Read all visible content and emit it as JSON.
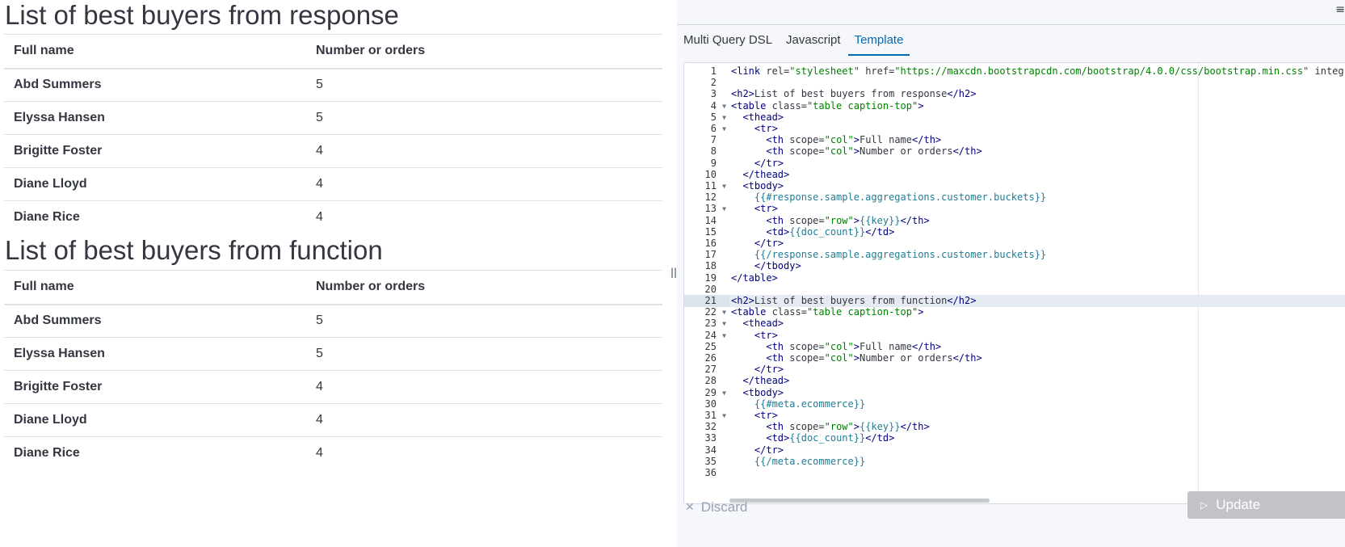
{
  "preview": {
    "sections": [
      {
        "title": "List of best buyers from response",
        "headers": [
          "Full name",
          "Number or orders"
        ],
        "rows": [
          {
            "name": "Abd Summers",
            "count": "5"
          },
          {
            "name": "Elyssa Hansen",
            "count": "5"
          },
          {
            "name": "Brigitte Foster",
            "count": "4"
          },
          {
            "name": "Diane Lloyd",
            "count": "4"
          },
          {
            "name": "Diane Rice",
            "count": "4"
          }
        ]
      },
      {
        "title": "List of best buyers from function",
        "headers": [
          "Full name",
          "Number or orders"
        ],
        "rows": [
          {
            "name": "Abd Summers",
            "count": "5"
          },
          {
            "name": "Elyssa Hansen",
            "count": "5"
          },
          {
            "name": "Brigitte Foster",
            "count": "4"
          },
          {
            "name": "Diane Lloyd",
            "count": "4"
          },
          {
            "name": "Diane Rice",
            "count": "4"
          }
        ]
      }
    ]
  },
  "splitter": {
    "handle": "||"
  },
  "panel": {
    "menu_icon": "≡",
    "tabs": [
      "Multi Query DSL",
      "Javascript",
      "Template"
    ],
    "active_tab": "Template",
    "code_lines": [
      [
        [
          "tag",
          "<link "
        ],
        [
          "txt",
          "rel="
        ],
        [
          "str",
          "\"stylesheet\""
        ],
        [
          "txt",
          " href="
        ],
        [
          "str",
          "\"https://maxcdn.bootstrapcdn.com/bootstrap/4.0.0/css/bootstrap.min.css\""
        ],
        [
          "txt",
          " integrit"
        ]
      ],
      [],
      [
        [
          "tag",
          "<h2>"
        ],
        [
          "txt",
          "List of best buyers from response"
        ],
        [
          "tag",
          "</h2>"
        ]
      ],
      [
        [
          "tag",
          "<table "
        ],
        [
          "txt",
          "class="
        ],
        [
          "str",
          "\"table caption-top\""
        ],
        [
          "tag",
          ">"
        ]
      ],
      [
        [
          "txt",
          "  "
        ],
        [
          "tag",
          "<thead>"
        ]
      ],
      [
        [
          "txt",
          "    "
        ],
        [
          "tag",
          "<tr>"
        ]
      ],
      [
        [
          "txt",
          "      "
        ],
        [
          "tag",
          "<th "
        ],
        [
          "txt",
          "scope="
        ],
        [
          "str",
          "\"col\""
        ],
        [
          "tag",
          ">"
        ],
        [
          "txt",
          "Full name"
        ],
        [
          "tag",
          "</th>"
        ]
      ],
      [
        [
          "txt",
          "      "
        ],
        [
          "tag",
          "<th "
        ],
        [
          "txt",
          "scope="
        ],
        [
          "str",
          "\"col\""
        ],
        [
          "tag",
          ">"
        ],
        [
          "txt",
          "Number or orders"
        ],
        [
          "tag",
          "</th>"
        ]
      ],
      [
        [
          "txt",
          "    "
        ],
        [
          "tag",
          "</tr>"
        ]
      ],
      [
        [
          "txt",
          "  "
        ],
        [
          "tag",
          "</thead>"
        ]
      ],
      [
        [
          "txt",
          "  "
        ],
        [
          "tag",
          "<tbody>"
        ]
      ],
      [
        [
          "txt",
          "    "
        ],
        [
          "mus",
          "{{#response.sample.aggregations.customer.buckets}}"
        ]
      ],
      [
        [
          "txt",
          "    "
        ],
        [
          "tag",
          "<tr>"
        ]
      ],
      [
        [
          "txt",
          "      "
        ],
        [
          "tag",
          "<th "
        ],
        [
          "txt",
          "scope="
        ],
        [
          "str",
          "\"row\""
        ],
        [
          "tag",
          ">"
        ],
        [
          "mus",
          "{{key}}"
        ],
        [
          "tag",
          "</th>"
        ]
      ],
      [
        [
          "txt",
          "      "
        ],
        [
          "tag",
          "<td>"
        ],
        [
          "mus",
          "{{doc_count}}"
        ],
        [
          "tag",
          "</td>"
        ]
      ],
      [
        [
          "txt",
          "    "
        ],
        [
          "tag",
          "</tr>"
        ]
      ],
      [
        [
          "txt",
          "    "
        ],
        [
          "mus",
          "{{/response.sample.aggregations.customer.buckets}}"
        ]
      ],
      [
        [
          "txt",
          "    "
        ],
        [
          "tag",
          "</tbody>"
        ]
      ],
      [
        [
          "tag",
          "</table>"
        ]
      ],
      [],
      [
        [
          "tag",
          "<h2>"
        ],
        [
          "txt",
          "List of best buyers from function"
        ],
        [
          "tag",
          "</h2>"
        ]
      ],
      [
        [
          "tag",
          "<table "
        ],
        [
          "txt",
          "class="
        ],
        [
          "str",
          "\"table caption-top\""
        ],
        [
          "tag",
          ">"
        ]
      ],
      [
        [
          "txt",
          "  "
        ],
        [
          "tag",
          "<thead>"
        ]
      ],
      [
        [
          "txt",
          "    "
        ],
        [
          "tag",
          "<tr>"
        ]
      ],
      [
        [
          "txt",
          "      "
        ],
        [
          "tag",
          "<th "
        ],
        [
          "txt",
          "scope="
        ],
        [
          "str",
          "\"col\""
        ],
        [
          "tag",
          ">"
        ],
        [
          "txt",
          "Full name"
        ],
        [
          "tag",
          "</th>"
        ]
      ],
      [
        [
          "txt",
          "      "
        ],
        [
          "tag",
          "<th "
        ],
        [
          "txt",
          "scope="
        ],
        [
          "str",
          "\"col\""
        ],
        [
          "tag",
          ">"
        ],
        [
          "txt",
          "Number or orders"
        ],
        [
          "tag",
          "</th>"
        ]
      ],
      [
        [
          "txt",
          "    "
        ],
        [
          "tag",
          "</tr>"
        ]
      ],
      [
        [
          "txt",
          "  "
        ],
        [
          "tag",
          "</thead>"
        ]
      ],
      [
        [
          "txt",
          "  "
        ],
        [
          "tag",
          "<tbody>"
        ]
      ],
      [
        [
          "txt",
          "    "
        ],
        [
          "mus",
          "{{#meta.ecommerce}}"
        ]
      ],
      [
        [
          "txt",
          "    "
        ],
        [
          "tag",
          "<tr>"
        ]
      ],
      [
        [
          "txt",
          "      "
        ],
        [
          "tag",
          "<th "
        ],
        [
          "txt",
          "scope="
        ],
        [
          "str",
          "\"row\""
        ],
        [
          "tag",
          ">"
        ],
        [
          "mus",
          "{{key}}"
        ],
        [
          "tag",
          "</th>"
        ]
      ],
      [
        [
          "txt",
          "      "
        ],
        [
          "tag",
          "<td>"
        ],
        [
          "mus",
          "{{doc_count}}"
        ],
        [
          "tag",
          "</td>"
        ]
      ],
      [
        [
          "txt",
          "    "
        ],
        [
          "tag",
          "</tr>"
        ]
      ],
      [
        [
          "txt",
          "    "
        ],
        [
          "mus",
          "{{/meta.ecommerce}}"
        ]
      ],
      []
    ],
    "foldable_lines": [
      4,
      5,
      6,
      11,
      13,
      22,
      23,
      24,
      29,
      31
    ],
    "active_line": 21,
    "discard_label": "Discard",
    "update_label": "Update",
    "colors": {
      "accent": "#006bb4",
      "tag": "#000080",
      "string": "#008000",
      "mustache": "#1f7c94"
    }
  }
}
